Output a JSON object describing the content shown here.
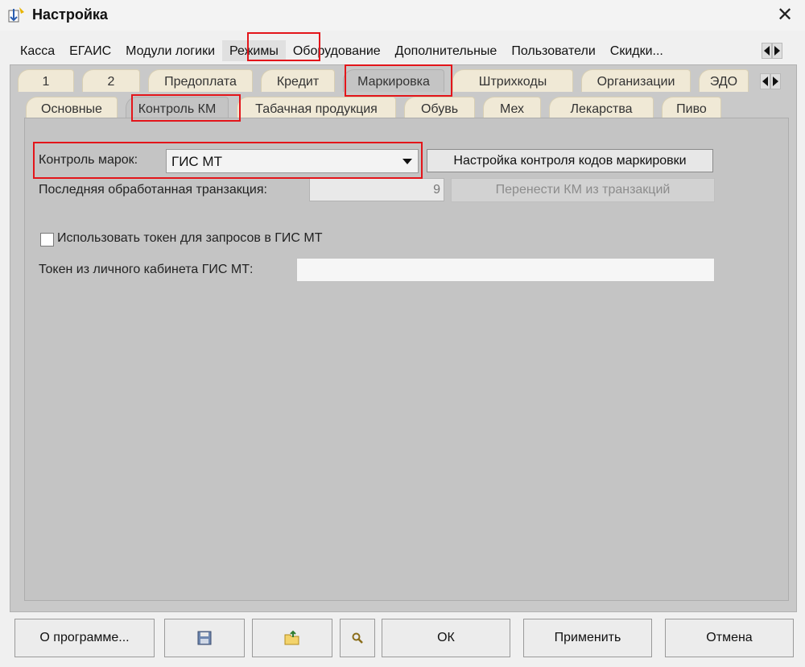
{
  "window": {
    "title": "Настройка",
    "icon": "settings-app-icon",
    "close_icon": "close-icon"
  },
  "tabs_level1": [
    {
      "label": "Касса"
    },
    {
      "label": "ЕГАИС"
    },
    {
      "label": "Модули логики"
    },
    {
      "label": "Режимы",
      "active": true
    },
    {
      "label": "Оборудование"
    },
    {
      "label": "Дополнительные"
    },
    {
      "label": "Пользователи"
    },
    {
      "label": "Скидки..."
    }
  ],
  "tabs_level2": [
    {
      "label": "1"
    },
    {
      "label": "2"
    },
    {
      "label": "Предоплата"
    },
    {
      "label": "Кредит"
    },
    {
      "label": "Маркировка",
      "active": true
    },
    {
      "label": "Штрихкоды"
    },
    {
      "label": "Организации"
    },
    {
      "label": "ЭДО"
    }
  ],
  "tabs_level3": [
    {
      "label": "Основные"
    },
    {
      "label": "Контроль КМ",
      "active": true
    },
    {
      "label": "Табачная продукция"
    },
    {
      "label": "Обувь"
    },
    {
      "label": "Мех"
    },
    {
      "label": "Лекарства"
    },
    {
      "label": "Пиво"
    }
  ],
  "form": {
    "marks_control_label": "Контроль марок:",
    "marks_control_value": "ГИС МТ",
    "settings_button": "Настройка контроля кодов маркировки",
    "last_transaction_label": "Последняя обработанная транзакция:",
    "last_transaction_value": "9",
    "transfer_button": "Перенести КМ из транзакций",
    "use_token_label": "Использовать токен для запросов в ГИС МТ",
    "use_token_checked": false,
    "token_label": "Токен из личного кабинета ГИС МТ:",
    "token_value": ""
  },
  "footer": {
    "about_button": "О программе...",
    "save_icon": "floppy-disk-icon",
    "open_icon": "folder-open-icon",
    "search_icon": "magnifier-icon",
    "ok_button": "ОК",
    "apply_button": "Применить",
    "cancel_button": "Отмена"
  },
  "colors": {
    "highlight": "#e3151a",
    "tab_bg": "#f0e9d6",
    "panel_bg": "#c4c4c4"
  }
}
